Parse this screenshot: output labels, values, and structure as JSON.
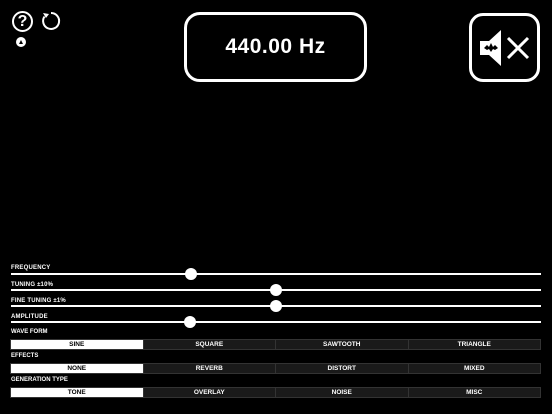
{
  "header": {
    "help_glyph": "?",
    "frequency_display": "440.00 Hz",
    "reset_icon": "reset-icon",
    "mute_icon": "speaker-muted-icon"
  },
  "sliders": [
    {
      "label": "FREQUENCY",
      "value": 0.34
    },
    {
      "label": "TUNING ±10%",
      "value": 0.5
    },
    {
      "label": "FINE TUNING ±1%",
      "value": 0.5
    },
    {
      "label": "AMPLITUDE",
      "value": 0.338
    }
  ],
  "wave_form": {
    "label": "WAVE FORM",
    "options": [
      "SINE",
      "SQUARE",
      "SAWTOOTH",
      "TRIANGLE"
    ],
    "selected": "SINE"
  },
  "effects": {
    "label": "EFFECTS",
    "options": [
      "NONE",
      "REVERB",
      "DISTORT",
      "MIXED"
    ],
    "selected": "NONE"
  },
  "generation_type": {
    "label": "GENERATION TYPE",
    "options": [
      "TONE",
      "OVERLAY",
      "NOISE",
      "MISC"
    ],
    "selected": "TONE"
  }
}
